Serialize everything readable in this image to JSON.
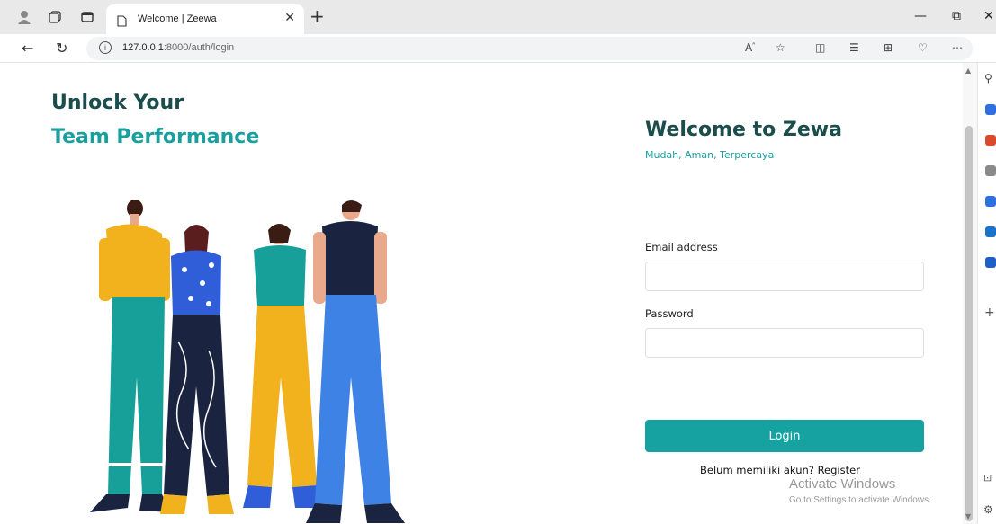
{
  "browser": {
    "tab_title": "Welcome | Zeewa",
    "url_host": "127.0.0.1",
    "url_path": ":8000/auth/login"
  },
  "page": {
    "hero_line1": "Unlock Your",
    "hero_line2": "Team Performance",
    "welcome_title": "Welcome to Zewa",
    "tagline": "Mudah, Aman, Terpercaya",
    "email_label": "Email address",
    "email_value": "",
    "password_label": "Password",
    "password_value": "",
    "login_button": "Login",
    "register_text": "Belum memiliki akun? Register"
  },
  "overlay": {
    "activate_title": "Activate Windows",
    "activate_sub": "Go to Settings to activate Windows."
  },
  "colors": {
    "primary": "#17a2a2",
    "heading": "#1b4d4d",
    "accent": "#1a9e9e"
  }
}
